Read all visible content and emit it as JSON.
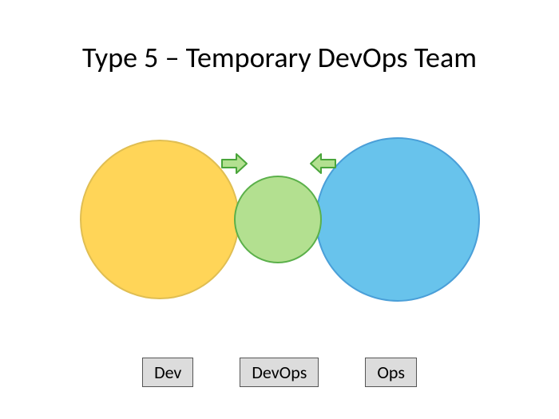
{
  "title": "Type 5 – Temporary DevOps Team",
  "circles": {
    "dev": {
      "color": "#ffd558",
      "border": "#e0be52"
    },
    "devops": {
      "color": "#b3e090",
      "border": "#5bb04a"
    },
    "ops": {
      "color": "#68c3ec",
      "border": "#4a9fd8"
    }
  },
  "arrows": {
    "color_fill": "#b3e090",
    "color_stroke": "#4aa53a"
  },
  "legend": {
    "dev": "Dev",
    "devops": "DevOps",
    "ops": "Ops"
  }
}
